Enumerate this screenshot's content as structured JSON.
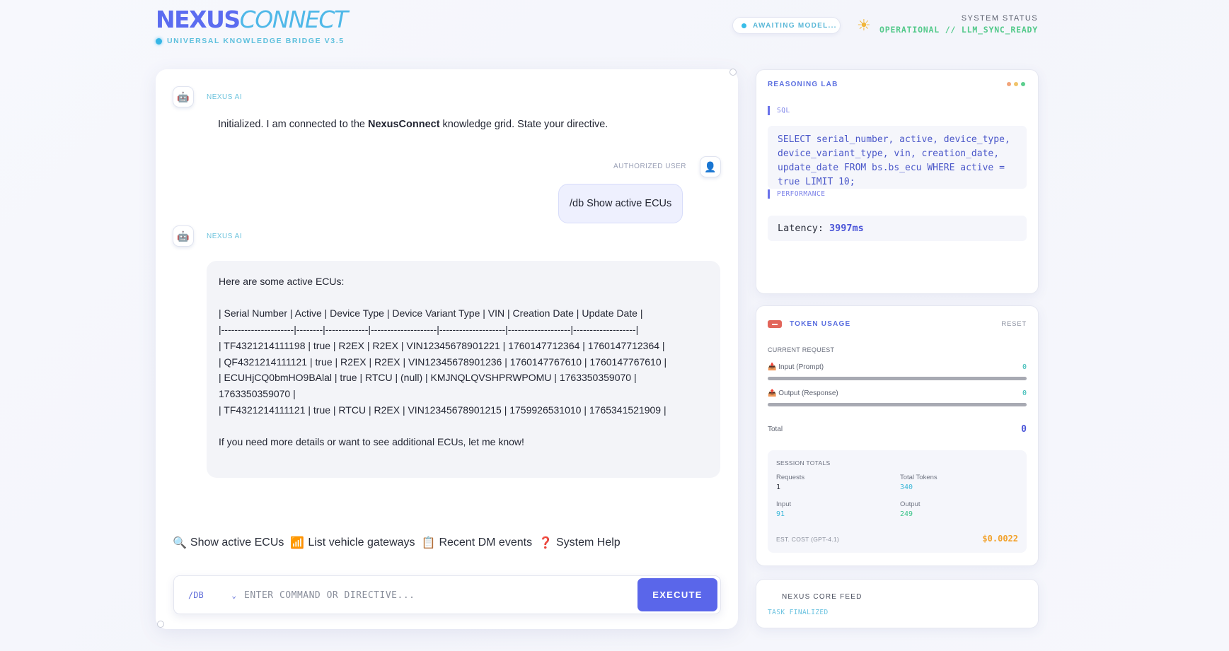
{
  "header": {
    "logo_part1": "NEXUS",
    "logo_part2": "CONNECT",
    "subtitle": "UNIVERSAL KNOWLEDGE BRIDGE V3.5",
    "model_status": "AWAITING MODEL...",
    "system_status_title": "SYSTEM STATUS",
    "system_status_value": "OPERATIONAL // LLM_SYNC_READY"
  },
  "chat": {
    "ai_label": "NEXUS AI",
    "user_label": "AUTHORIZED USER",
    "greeting_pre": "Initialized. I am connected to the ",
    "greeting_bold": "NexusConnect",
    "greeting_post": " knowledge grid. State your directive.",
    "user_message": "/db Show active ECUs",
    "reply_lines": [
      "Here are some active ECUs:",
      "",
      "| Serial Number | Active | Device Type | Device Variant Type | VIN | Creation Date | Update Date |",
      "|----------------------|--------|-------------|--------------------|--------------------|-------------------|-------------------|",
      "| TF4321214111198 | true | R2EX | R2EX | VIN12345678901221 | 1760147712364 | 1760147712364 |",
      "| QF4321214111121 | true | R2EX | R2EX | VIN12345678901236 | 1760147767610 | 1760147767610 |",
      "| ECUHjCQ0bmHO9BAlal | true | RTCU | (null) | KMJNQLQVSHPRWPOMU | 1763350359070 | 1763350359070 |",
      "| TF4321214111121 | true | RTCU | R2EX | VIN12345678901215 | 1759926531010 | 1765341521909 |",
      "",
      "If you need more details or want to see additional ECUs, let me know!"
    ],
    "quick_actions": [
      {
        "icon": "🔍",
        "label": "Show active ECUs"
      },
      {
        "icon": "📶",
        "label": "List vehicle gateways"
      },
      {
        "icon": "📋",
        "label": "Recent DM events"
      },
      {
        "icon": "❓",
        "label": "System Help"
      }
    ],
    "mode_select": "/DB",
    "input_placeholder": "ENTER COMMAND OR DIRECTIVE...",
    "input_value": "",
    "execute_label": "EXECUTE"
  },
  "reasoning_lab": {
    "title": "REASONING LAB",
    "sql_label": "SQL",
    "sql_query": "SELECT serial_number, active, device_type, device_variant_type, vin, creation_date, update_date FROM bs.bs_ecu WHERE active = true LIMIT 10;",
    "performance_label": "PERFORMANCE",
    "latency_label": "Latency:",
    "latency_value": "3997ms",
    "status_dot_colors": [
      "#f2a47a",
      "#f0c36a",
      "#5ccf8e"
    ]
  },
  "token_usage": {
    "title": "TOKEN USAGE",
    "reset_label": "RESET",
    "current_request_label": "CURRENT REQUEST",
    "input_label": "📥 Input (Prompt)",
    "input_value": "0",
    "output_label": "📤 Output (Response)",
    "output_value": "0",
    "total_label": "Total",
    "total_value": "0",
    "session_title": "SESSION TOTALS",
    "requests_label": "Requests",
    "requests_value": "1",
    "total_tokens_label": "Total Tokens",
    "total_tokens_value": "340",
    "session_input_label": "Input",
    "session_input_value": "91",
    "session_output_label": "Output",
    "session_output_value": "249",
    "cost_label": "EST. COST (GPT-4.1)",
    "cost_value": "$0.0022"
  },
  "core_feed": {
    "title": "NEXUS CORE FEED",
    "status": "TASK FINALIZED"
  },
  "colors": {
    "accent": "#5a66ea",
    "cyan": "#4fb8e8",
    "operational": "#52c98a",
    "cost": "#f2a22c"
  }
}
